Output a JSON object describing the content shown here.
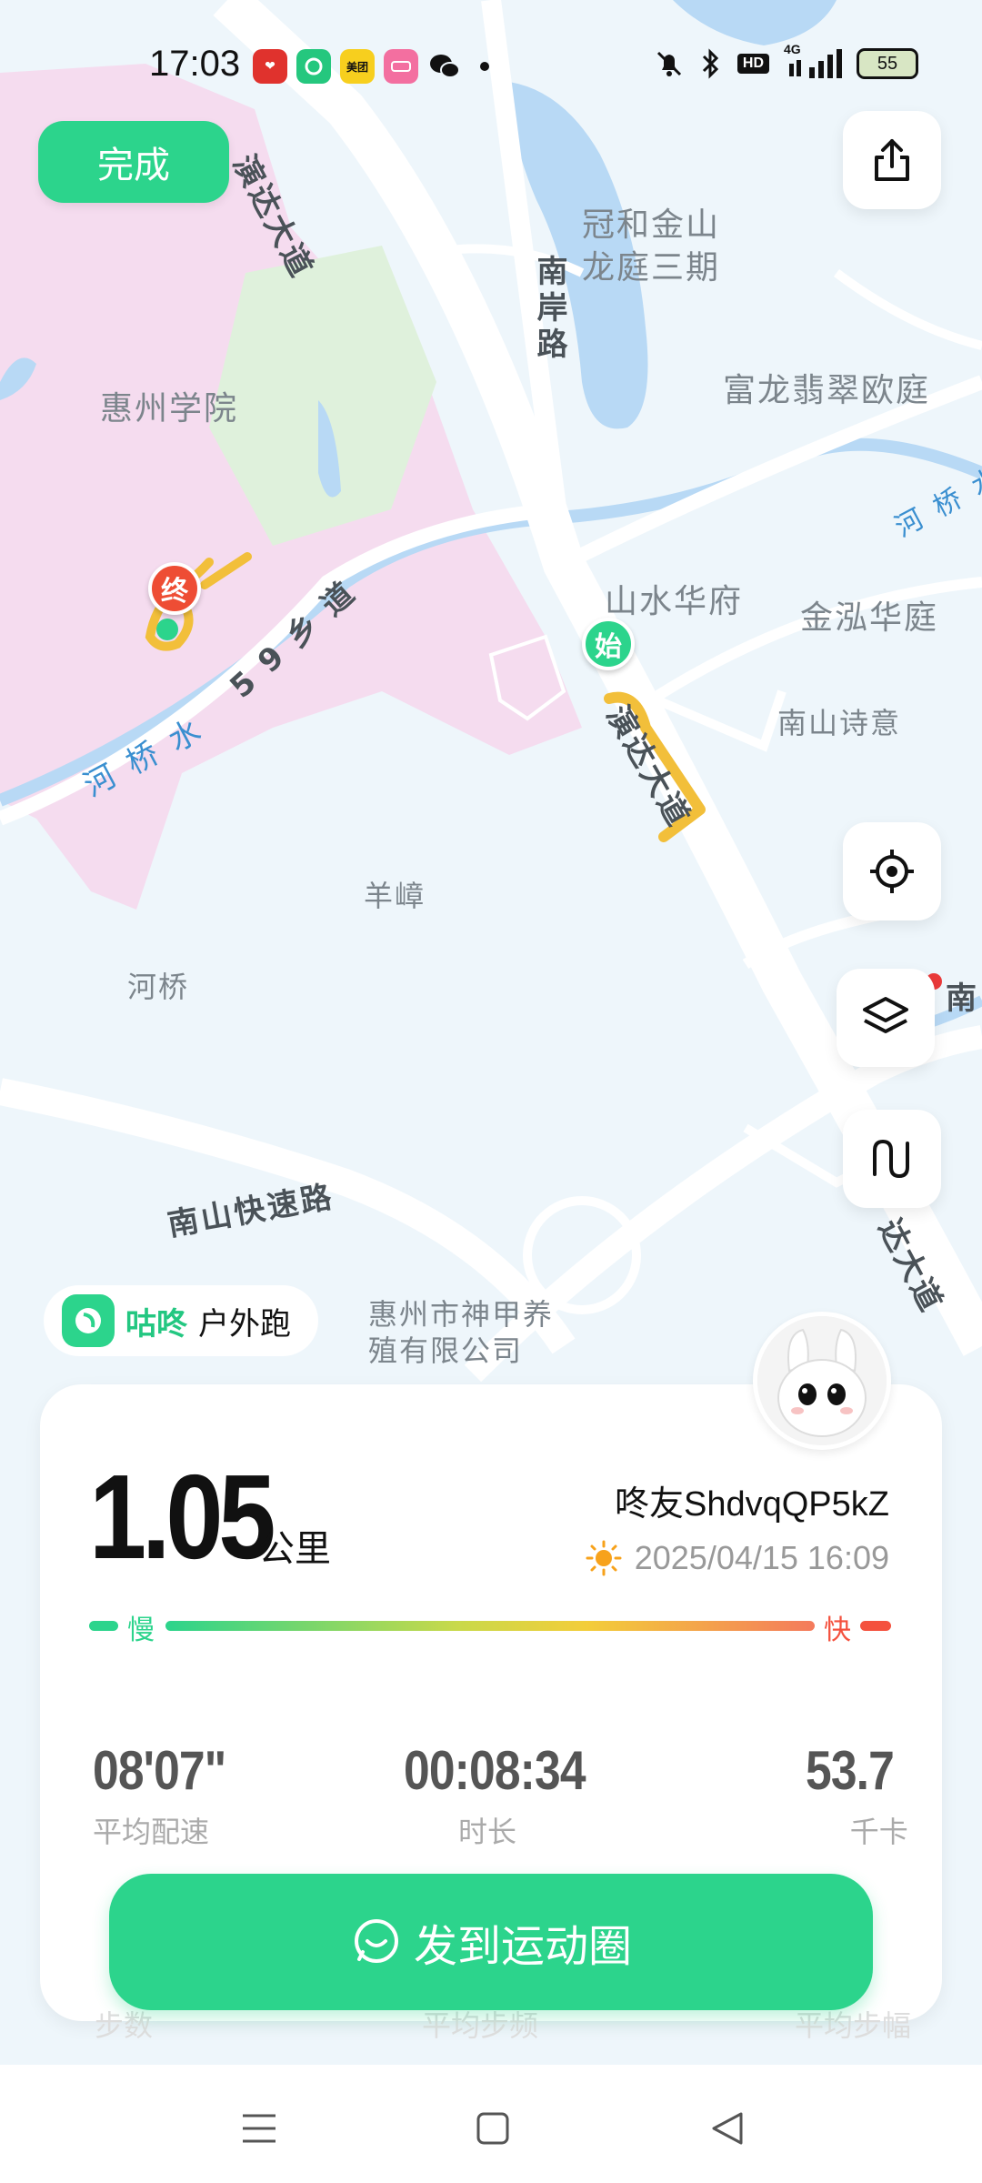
{
  "status_bar": {
    "time": "17:03",
    "app_icons": [
      {
        "name": "pinduoduo-icon",
        "color": "#e0322d",
        "glyph": "❤"
      },
      {
        "name": "gudong-icon",
        "color": "#25c77e",
        "glyph": ""
      },
      {
        "name": "meituan-icon",
        "color": "#f7cf1e",
        "glyph": "美团"
      },
      {
        "name": "app-pink-icon",
        "color": "#f36fa0",
        "glyph": ""
      },
      {
        "name": "wechat-icon",
        "color": "#111111",
        "glyph": ""
      }
    ],
    "hd_label": "HD",
    "network": "4G",
    "battery": "55"
  },
  "header": {
    "done_label": "完成"
  },
  "map": {
    "places": {
      "huizhou_college": "惠州学院",
      "guanhe_line1": "冠和金山",
      "guanhe_line2": "龙庭三期",
      "fulong": "富龙翡翠欧庭",
      "shanshui": "山水华府",
      "jinhong": "金泓华庭",
      "nanshan_poem": "南山诗意",
      "yangzhang": "羊嶂",
      "heqiao": "河桥",
      "shenjia_line1": "惠州市神甲养",
      "shenjia_line2": "殖有限公司"
    },
    "roads": {
      "yanda_top": "演达大道",
      "nanan": "南岸路",
      "road59": "5 9 乡 道",
      "yanda_mid": "演达大道",
      "nanshan_expressway": "南山快速路",
      "yanda_bottom": "达大道",
      "nan_right": "南"
    },
    "water": {
      "heqiao_water_left": "河 桥 水",
      "heqiao_water_right": "河 桥 水"
    },
    "start_marker": "始",
    "end_marker": "终"
  },
  "brand": {
    "name": "咕咚",
    "mode": "户外跑"
  },
  "stats": {
    "distance": "1.05",
    "distance_unit": "公里",
    "username": "咚友ShdvqQP5kZ",
    "datetime": "2025/04/15 16:09",
    "pace_slow": "慢",
    "pace_fast": "快",
    "avg_pace": {
      "value": "08'07\"",
      "label": "平均配速"
    },
    "duration": {
      "value": "00:08:34",
      "label": "时长"
    },
    "calories": {
      "value": "53.7",
      "label": "千卡"
    },
    "hidden_labels": [
      "步数",
      "平均步频",
      "平均步幅"
    ]
  },
  "share_button_label": "发到运动圈",
  "colors": {
    "accent": "#2cd48c",
    "route": "#f2bf3a",
    "end_marker": "#ee4d34",
    "start_marker": "#2cd48c"
  }
}
